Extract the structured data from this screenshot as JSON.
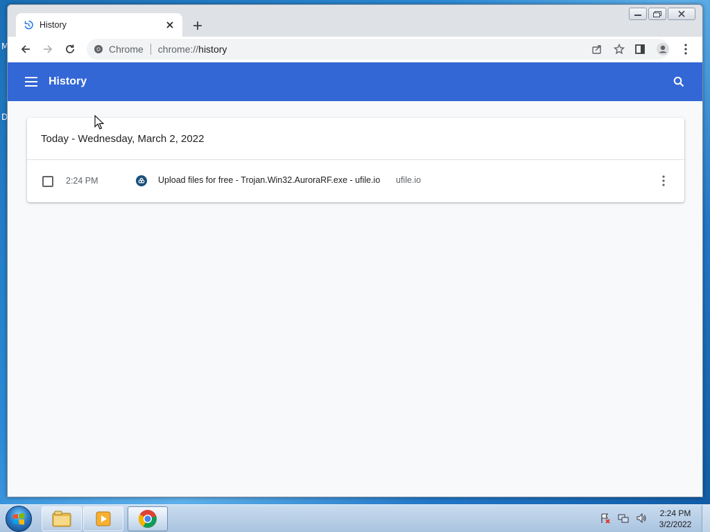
{
  "desktop": {
    "edge_letters": [
      "M",
      "D"
    ]
  },
  "browser": {
    "tab": {
      "title": "History"
    },
    "omnibox": {
      "chip": "Chrome",
      "url_scheme": "chrome://",
      "url_host": "history"
    }
  },
  "history": {
    "header_title": "History",
    "groups": [
      {
        "date": "Today - Wednesday, March 2, 2022",
        "entries": [
          {
            "time": "2:24 PM",
            "title": "Upload files for free - Trojan.Win32.AuroraRF.exe - ufile.io",
            "domain": "ufile.io"
          }
        ]
      }
    ]
  },
  "taskbar": {
    "clock_time": "2:24 PM",
    "clock_date": "3/2/2022"
  },
  "colors": {
    "header_blue": "#3367d6",
    "page_bg": "#f8f9fa",
    "tab_strip": "#dee1e6"
  }
}
